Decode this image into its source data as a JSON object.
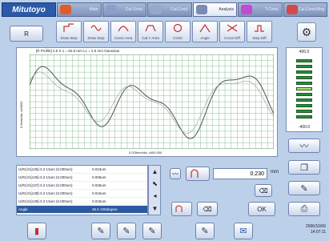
{
  "header": {
    "logo": "Mitutoyo",
    "tabs": [
      {
        "label": "Main",
        "active": false
      },
      {
        "label": "Cal.Cond.",
        "active": false
      },
      {
        "label": "Cal.Cond.",
        "active": false
      },
      {
        "label": "Analysis",
        "active": true
      },
      {
        "label": "T-Cond.",
        "active": false
      },
      {
        "label": "Cal.Cond.Mng",
        "active": false
      }
    ]
  },
  "toolbar": {
    "r_button": "R",
    "tools": [
      "Draw Step",
      "Draw Step",
      "Curve Area",
      "Cal.Y Area",
      "Circle",
      "Angle",
      "Cross Diff",
      "Step Diff"
    ]
  },
  "graph": {
    "header": "[R Profile]   2.5 X 1 = 62.5 mm   Lc = 2.5 mm   Gaussian",
    "ylabel": "0.5mm/div, x40000",
    "xlabel": "0.025mm/div, x400.000"
  },
  "scale": {
    "top": "400.0",
    "bottom": "-400.0"
  },
  "results": {
    "rows": [
      {
        "label": "U(Rz)/1[135]-3.3 13um (0.000um)",
        "value": "0.023um"
      },
      {
        "label": "U(Rz)/1[136]-3.3 13um (0.000um)",
        "value": "0.005um"
      },
      {
        "label": "U(Rz)/1[137]-3.3 13um (0.000um)",
        "value": "0.026um"
      },
      {
        "label": "U(Rz)/1[138]-3.3 13um (0.000um)",
        "value": "0.016um"
      },
      {
        "label": "U(Rz)/1[139]-3.3 13um (0.000um)",
        "value": "0.018um"
      },
      {
        "label": "Angle",
        "value": "35.5 100degree"
      }
    ]
  },
  "param": {
    "value": "0.230",
    "unit": "mm",
    "ok": "OK"
  },
  "footer": {
    "date": "2006/10/06",
    "time": "14:07:11"
  }
}
